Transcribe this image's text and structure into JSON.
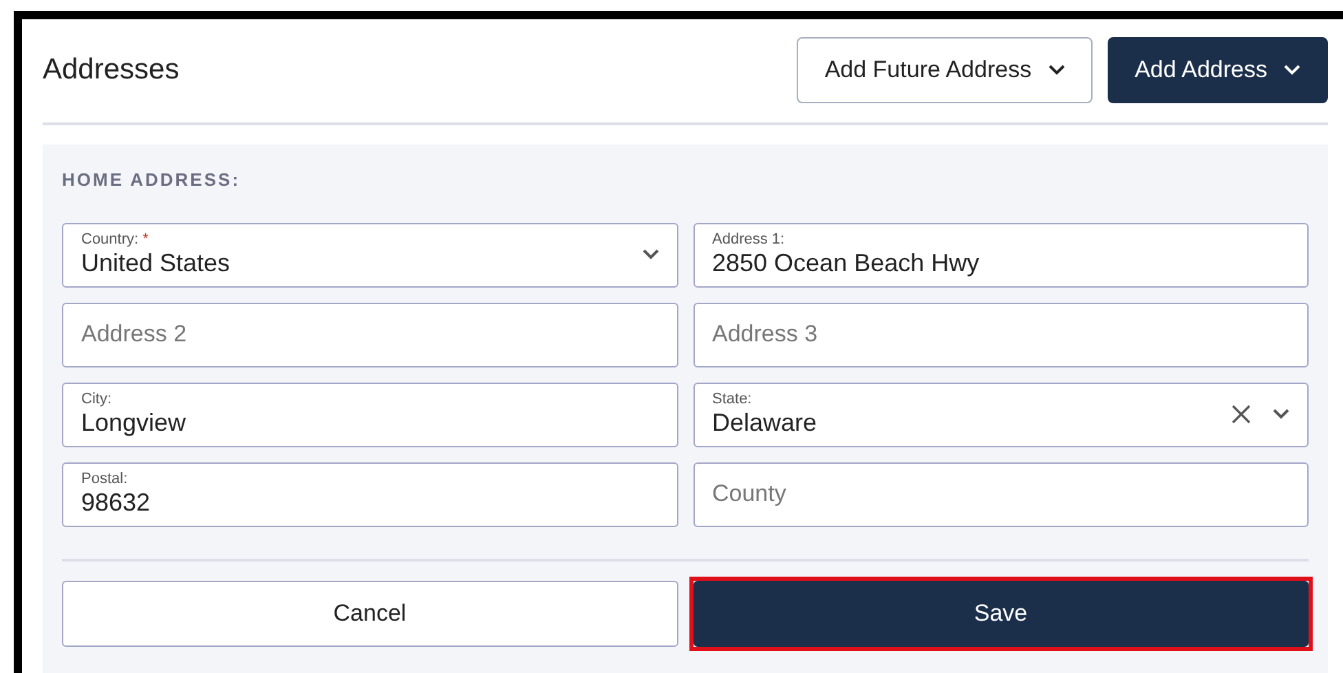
{
  "header": {
    "title": "Addresses",
    "buttons": [
      {
        "label": "Add Future Address",
        "kind": "outline"
      },
      {
        "label": "Add Address",
        "kind": "primary"
      }
    ]
  },
  "section": {
    "title": "HOME ADDRESS:",
    "fields": [
      {
        "kind": "select",
        "label": "Country:",
        "required_mark": "*",
        "value": "United States"
      },
      {
        "kind": "input",
        "label": "Address 1:",
        "value": "2850 Ocean Beach Hwy"
      },
      {
        "kind": "input",
        "placeholder": "Address 2"
      },
      {
        "kind": "input",
        "placeholder": "Address 3"
      },
      {
        "kind": "input",
        "label": "City:",
        "value": "Longview"
      },
      {
        "kind": "select",
        "label": "State:",
        "value": "Delaware",
        "clearable": true
      },
      {
        "kind": "input",
        "label": "Postal:",
        "value": "98632"
      },
      {
        "kind": "input",
        "placeholder": "County"
      }
    ],
    "buttons": [
      {
        "label": "Cancel",
        "kind": "outline",
        "highlighted": false
      },
      {
        "label": "Save",
        "kind": "primary",
        "highlighted": true
      }
    ]
  }
}
